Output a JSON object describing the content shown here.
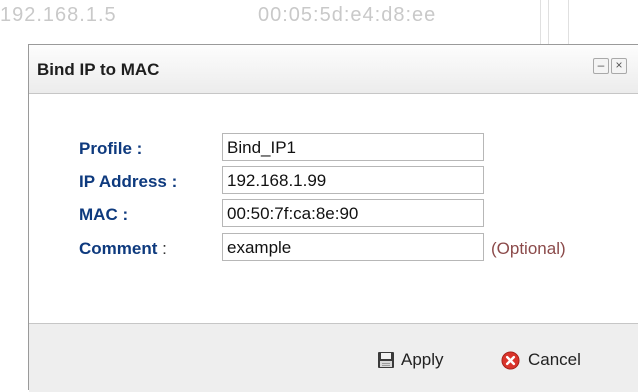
{
  "background": {
    "ip": "192.168.1.5",
    "mac": "00:05:5d:e4:d8:ee"
  },
  "dialog": {
    "title": "Bind IP to MAC",
    "fields": {
      "profile": {
        "label": "Profile :",
        "value": "Bind_IP1"
      },
      "ip": {
        "label": "IP Address :",
        "value": "192.168.1.99"
      },
      "mac": {
        "label": "MAC :",
        "value": "00:50:7f:ca:8e:90"
      },
      "comment": {
        "label": "Comment",
        "label_suffix": " :",
        "value": "example",
        "hint": "(Optional)"
      }
    },
    "buttons": {
      "apply": "Apply",
      "cancel": "Cancel"
    }
  },
  "colors": {
    "label": "#0e3a7e",
    "hint": "#8b4a4a",
    "cancel_icon": "#d9342b"
  },
  "icons": {
    "apply": "save-icon",
    "cancel": "cancel-icon",
    "minimize": "minimize-icon",
    "close": "close-icon"
  }
}
